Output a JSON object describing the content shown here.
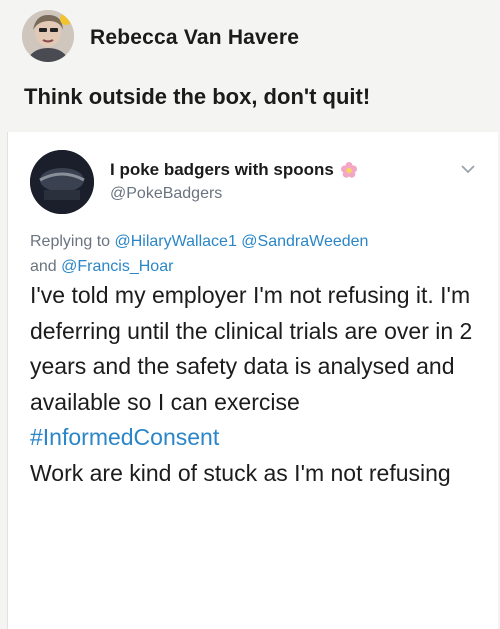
{
  "facebook_post": {
    "author": "Rebecca Van Havere",
    "text": "Think outside the box, don't quit!"
  },
  "tweet": {
    "display_name": "I poke badgers with spoons",
    "handle": "@PokeBadgers",
    "replying_to_prefix": "Replying to",
    "mentions": [
      "@HilaryWallace1",
      "@SandraWeeden",
      "@Francis_Hoar"
    ],
    "and_word": "and",
    "body_before_hashtag": "I've told my employer I'm not refusing it. I'm deferring until the clinical trials are over in 2 years and the safety data is analysed and available so I can exercise",
    "hashtag": "#InformedConsent",
    "body_after_hashtag": "Work are kind of stuck as I'm not refusing"
  },
  "colors": {
    "link": "#2a86c8",
    "muted": "#6a7480",
    "text": "#1c1c1c"
  },
  "icons": {
    "flower": "pink-flower-emoji",
    "menu": "chevron-down-icon"
  }
}
